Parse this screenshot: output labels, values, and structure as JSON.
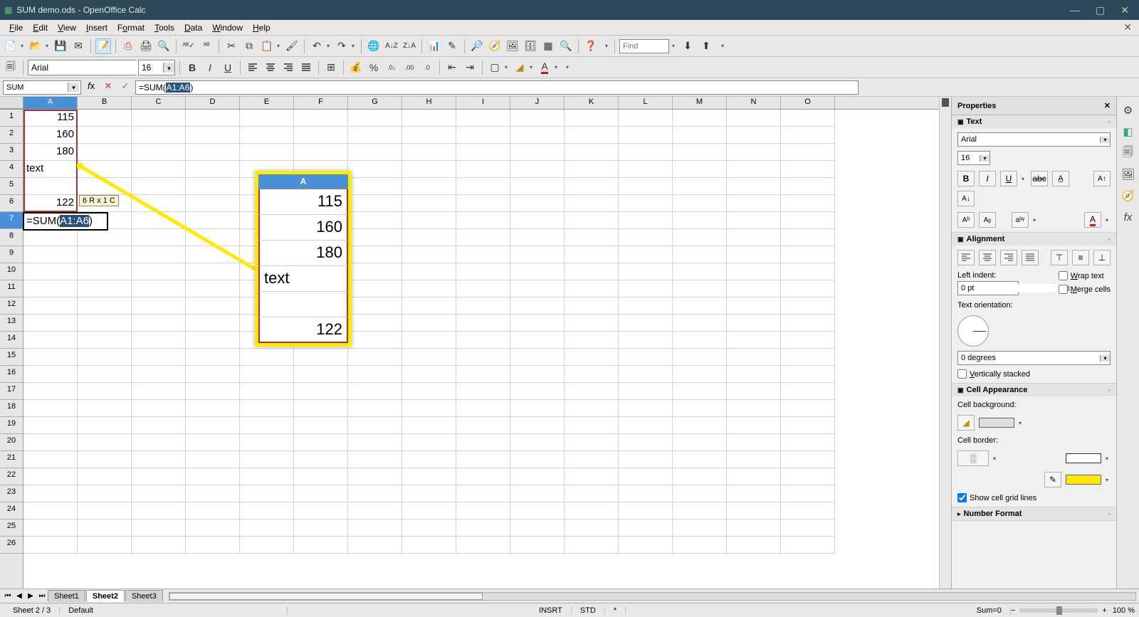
{
  "window_title": "SUM demo.ods - OpenOffice Calc",
  "menus": [
    "File",
    "Edit",
    "View",
    "Insert",
    "Format",
    "Tools",
    "Data",
    "Window",
    "Help"
  ],
  "toolbar4_find_placeholder": "Find",
  "format_bar": {
    "font": "Arial",
    "size": "16"
  },
  "formula_bar": {
    "name_box": "SUM",
    "input_prefix": "=SUM(",
    "input_sel": "A1:A6",
    "input_suffix": ")"
  },
  "columns": [
    "A",
    "B",
    "C",
    "D",
    "E",
    "F",
    "G",
    "H",
    "I",
    "J",
    "K",
    "L",
    "M",
    "N",
    "O"
  ],
  "rows": 26,
  "selected_col": "A",
  "selected_row": 7,
  "cells": {
    "A1": "115",
    "A2": "160",
    "A3": "180",
    "A4": "text",
    "A5": "",
    "A6": "122"
  },
  "active_cell_content": {
    "prefix": "=SUM(",
    "sel": "A1:A6",
    "suffix": ")"
  },
  "range_tooltip": "6 R x 1 C",
  "zoom_overlay": {
    "header": "A",
    "rows": [
      "115",
      "160",
      "180",
      "text",
      "",
      "122"
    ]
  },
  "sheet_tabs": {
    "tabs": [
      "Sheet1",
      "Sheet2",
      "Sheet3"
    ],
    "active": 1
  },
  "statusbar": {
    "sheet": "Sheet 2 / 3",
    "style": "Default",
    "insert": "INSRT",
    "std": "STD",
    "mod": "*",
    "sum": "Sum=0",
    "zoom": "100 %"
  },
  "properties": {
    "title": "Properties",
    "text": {
      "font": "Arial",
      "size": "16"
    },
    "alignment": {
      "indent_label": "Left indent:",
      "indent_value": "0 pt",
      "wrap_label": "Wrap text",
      "merge_label": "Merge cells",
      "orient_label": "Text orientation:",
      "degrees": "0 degrees",
      "vstack_label": "Vertically stacked"
    },
    "cellapp": {
      "bg_label": "Cell background:",
      "border_label": "Cell border:",
      "grid_label": "Show cell grid lines"
    },
    "numfmt": "Number Format"
  }
}
